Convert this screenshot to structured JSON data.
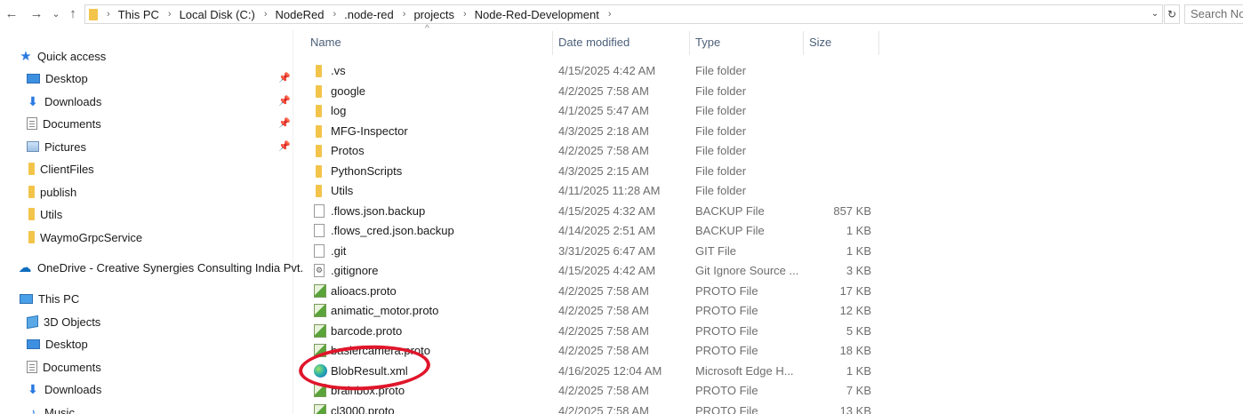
{
  "address_bar": {
    "back": "←",
    "forward": "→",
    "recent": "⌄",
    "up": "↑",
    "breadcrumbs": [
      "This PC",
      "Local Disk (C:)",
      "NodeRed",
      ".node-red",
      "projects",
      "Node-Red-Development"
    ],
    "search_placeholder": "Search Node-Red-Development"
  },
  "nav_pane": {
    "quick_access": "Quick access",
    "quick_items": [
      {
        "label": "Desktop",
        "icon": "desktop-icon",
        "pinned": true
      },
      {
        "label": "Downloads",
        "icon": "download-icon",
        "pinned": true
      },
      {
        "label": "Documents",
        "icon": "documents-icon",
        "pinned": true
      },
      {
        "label": "Pictures",
        "icon": "pictures-icon",
        "pinned": true
      },
      {
        "label": "ClientFiles",
        "icon": "folder-icon",
        "pinned": false
      },
      {
        "label": "publish",
        "icon": "folder-icon",
        "pinned": false
      },
      {
        "label": "Utils",
        "icon": "folder-icon",
        "pinned": false
      },
      {
        "label": "WaymoGrpcService",
        "icon": "folder-icon",
        "pinned": false
      }
    ],
    "onedrive": "OneDrive - Creative Synergies Consulting India Pvt.",
    "this_pc": "This PC",
    "pc_items": [
      {
        "label": "3D Objects",
        "icon": "3d-objects-icon"
      },
      {
        "label": "Desktop",
        "icon": "desktop-icon"
      },
      {
        "label": "Documents",
        "icon": "documents-icon"
      },
      {
        "label": "Downloads",
        "icon": "download-icon"
      },
      {
        "label": "Music",
        "icon": "music-icon"
      }
    ]
  },
  "columns": {
    "name": "Name",
    "date": "Date modified",
    "type": "Type",
    "size": "Size"
  },
  "files": [
    {
      "name": ".vs",
      "date": "4/15/2025 4:42 AM",
      "type": "File folder",
      "size": "",
      "icon": "folder"
    },
    {
      "name": "google",
      "date": "4/2/2025 7:58 AM",
      "type": "File folder",
      "size": "",
      "icon": "folder"
    },
    {
      "name": "log",
      "date": "4/1/2025 5:47 AM",
      "type": "File folder",
      "size": "",
      "icon": "folder"
    },
    {
      "name": "MFG-Inspector",
      "date": "4/3/2025 2:18 AM",
      "type": "File folder",
      "size": "",
      "icon": "folder"
    },
    {
      "name": "Protos",
      "date": "4/2/2025 7:58 AM",
      "type": "File folder",
      "size": "",
      "icon": "folder"
    },
    {
      "name": "PythonScripts",
      "date": "4/3/2025 2:15 AM",
      "type": "File folder",
      "size": "",
      "icon": "folder"
    },
    {
      "name": "Utils",
      "date": "4/11/2025 11:28 AM",
      "type": "File folder",
      "size": "",
      "icon": "folder"
    },
    {
      "name": ".flows.json.backup",
      "date": "4/15/2025 4:32 AM",
      "type": "BACKUP File",
      "size": "857 KB",
      "icon": "file"
    },
    {
      "name": ".flows_cred.json.backup",
      "date": "4/14/2025 2:51 AM",
      "type": "BACKUP File",
      "size": "1 KB",
      "icon": "file"
    },
    {
      "name": ".git",
      "date": "3/31/2025 6:47 AM",
      "type": "GIT File",
      "size": "1 KB",
      "icon": "file"
    },
    {
      "name": ".gitignore",
      "date": "4/15/2025 4:42 AM",
      "type": "Git Ignore Source ...",
      "size": "3 KB",
      "icon": "cfg"
    },
    {
      "name": "alioacs.proto",
      "date": "4/2/2025 7:58 AM",
      "type": "PROTO File",
      "size": "17 KB",
      "icon": "proto"
    },
    {
      "name": "animatic_motor.proto",
      "date": "4/2/2025 7:58 AM",
      "type": "PROTO File",
      "size": "12 KB",
      "icon": "proto"
    },
    {
      "name": "barcode.proto",
      "date": "4/2/2025 7:58 AM",
      "type": "PROTO File",
      "size": "5 KB",
      "icon": "proto"
    },
    {
      "name": "baslercamera.proto",
      "date": "4/2/2025 7:58 AM",
      "type": "PROTO File",
      "size": "18 KB",
      "icon": "proto"
    },
    {
      "name": "BlobResult.xml",
      "date": "4/16/2025 12:04 AM",
      "type": "Microsoft Edge H...",
      "size": "1 KB",
      "icon": "edge"
    },
    {
      "name": "brainbox.proto",
      "date": "4/2/2025 7:58 AM",
      "type": "PROTO File",
      "size": "7 KB",
      "icon": "proto"
    },
    {
      "name": "cl3000.proto",
      "date": "4/2/2025 7:58 AM",
      "type": "PROTO File",
      "size": "13 KB",
      "icon": "proto"
    }
  ],
  "annotation_color": "#e0162b"
}
